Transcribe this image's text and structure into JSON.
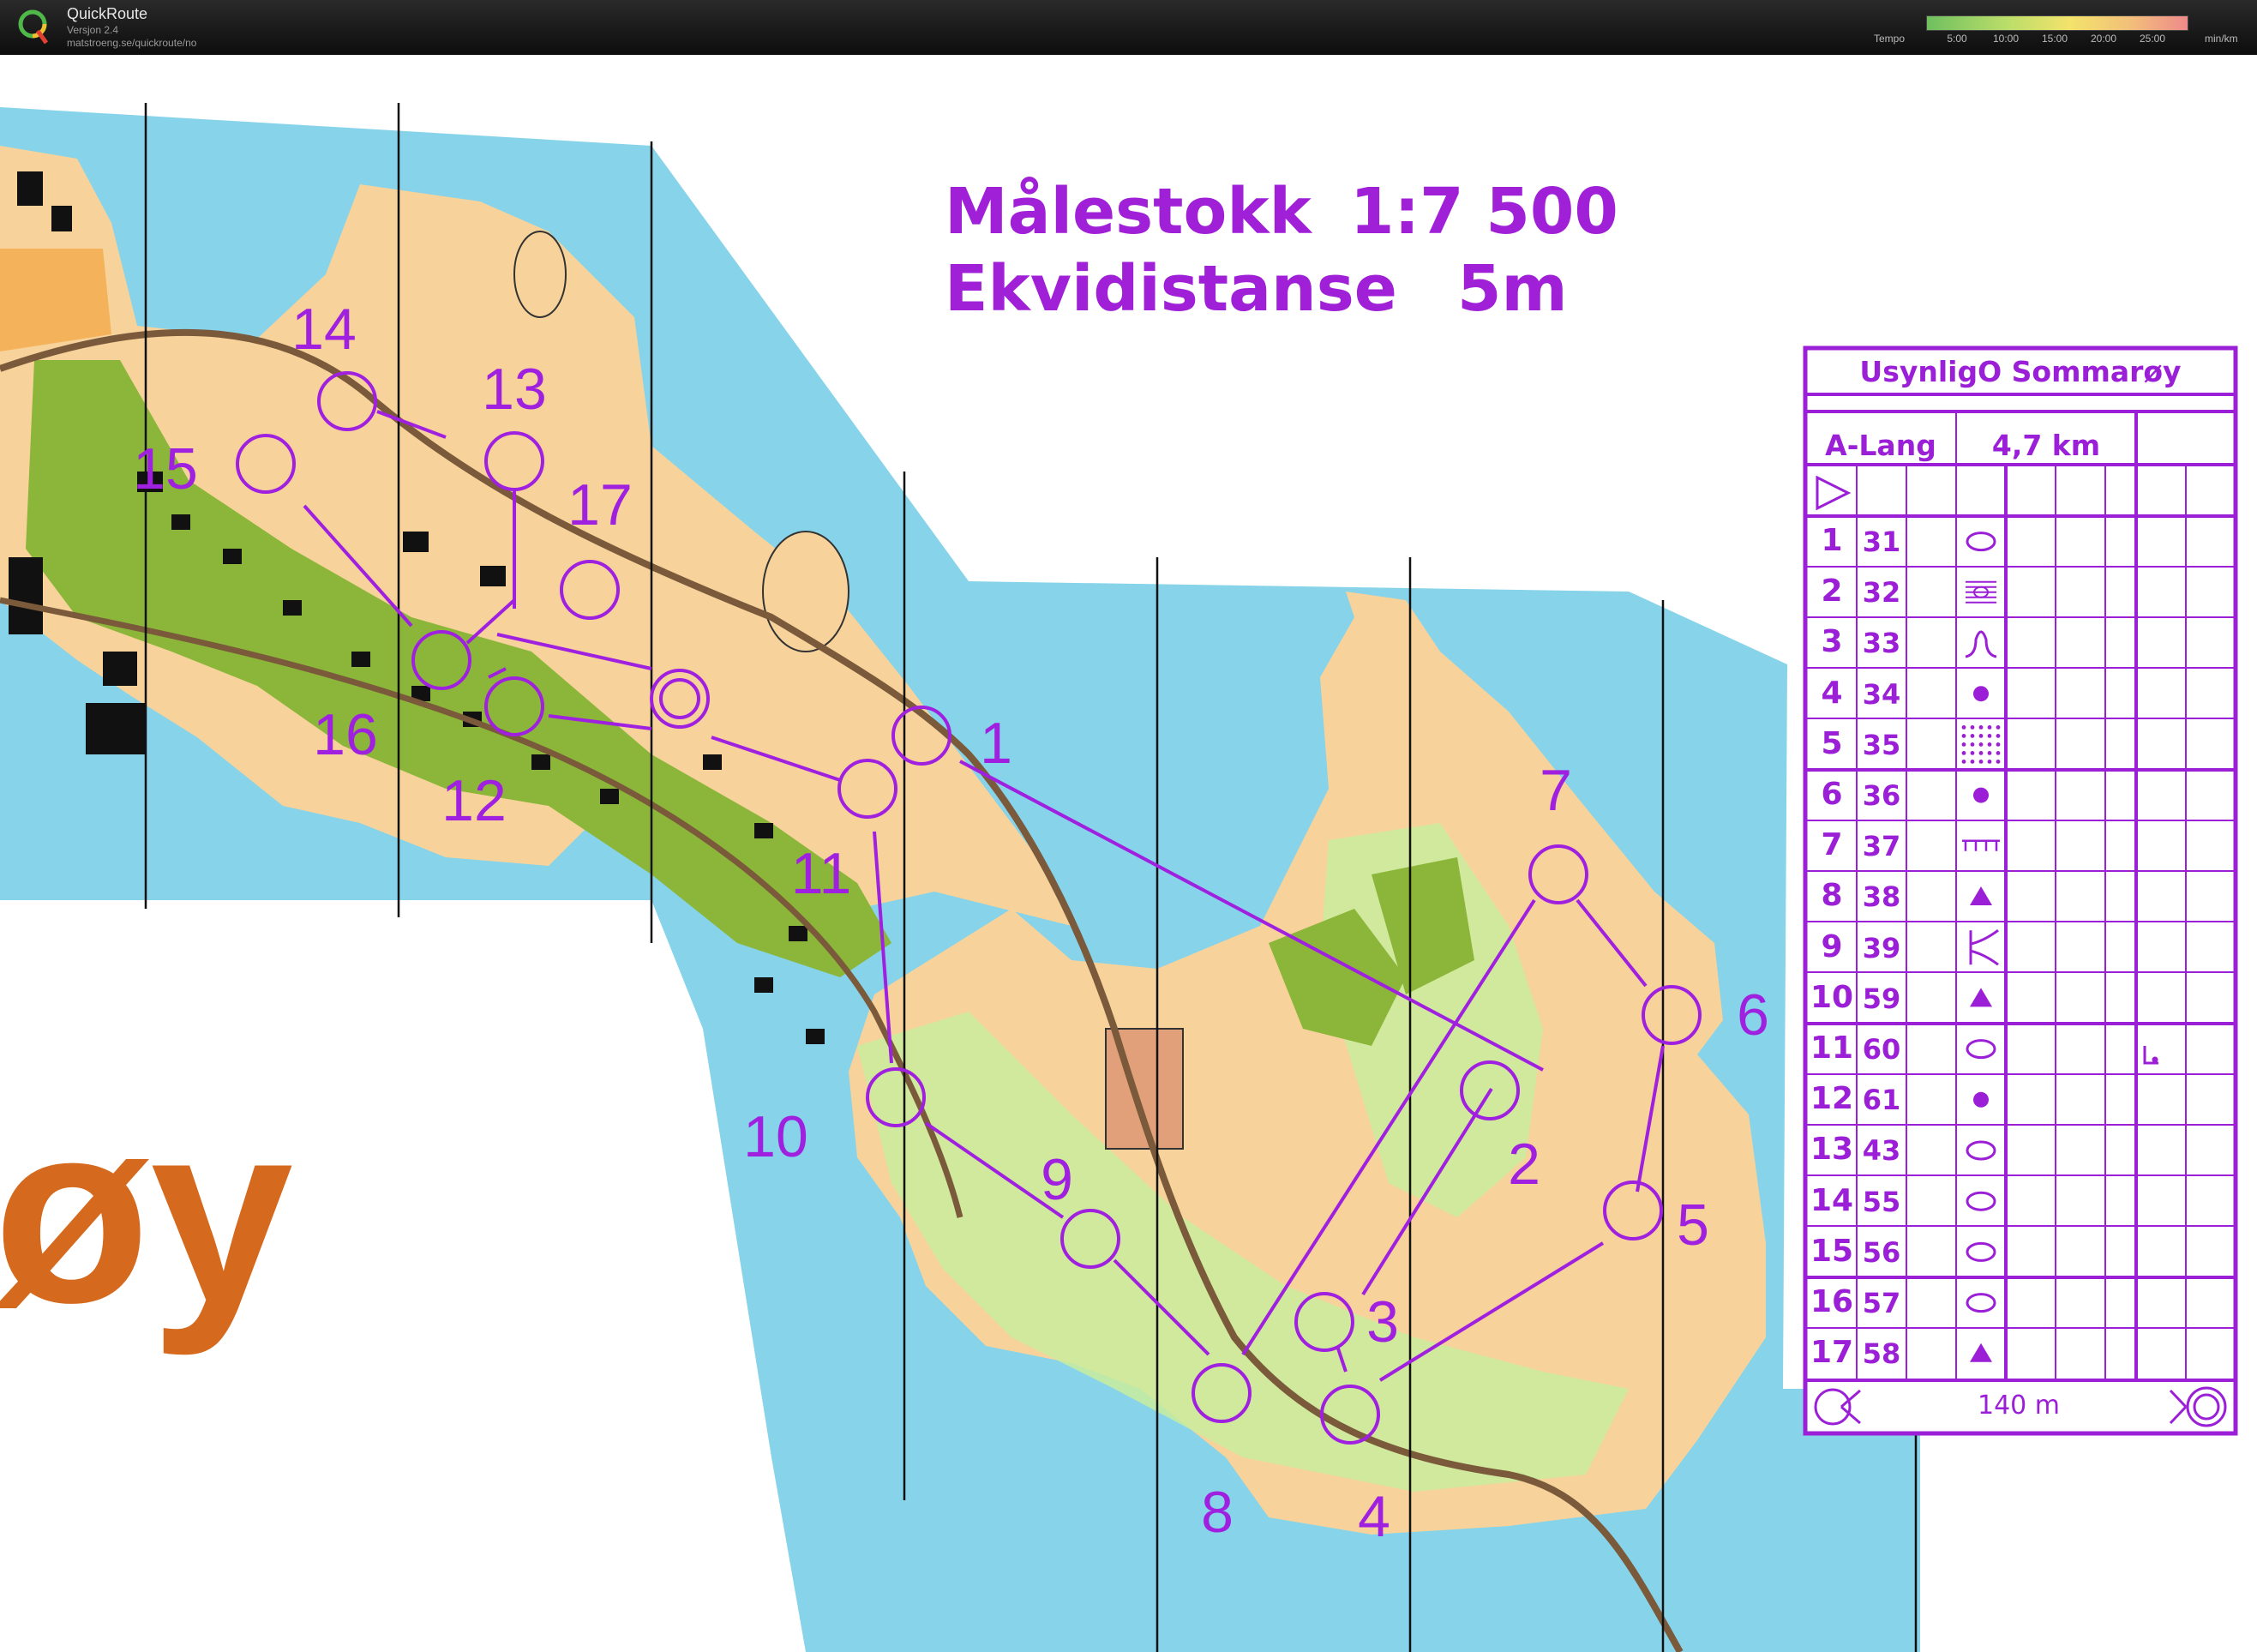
{
  "app": {
    "title": "QuickRoute",
    "version": "Versjon 2.4",
    "url": "matstroeng.se/quickroute/no"
  },
  "tempo_scale": {
    "label": "Tempo",
    "ticks": [
      "5:00",
      "10:00",
      "15:00",
      "20:00",
      "25:00"
    ],
    "unit": "min/km",
    "colors": [
      "#7ec86b",
      "#c7e36a",
      "#f4e36b",
      "#f2c37e",
      "#ef8e8e"
    ]
  },
  "map": {
    "scale_label": "Målestokk",
    "scale_value": "1:7 500",
    "contour_label": "Ekvidistanse",
    "contour_value": "5m",
    "place_text": "øy",
    "colors": {
      "water": "#86d3ea",
      "open_land": "#f7d39b",
      "forest_green": "#7aae2e",
      "light_green": "#c9ec9e",
      "course_purple": "#a020e0",
      "building": "#111111",
      "place_text": "#d56a1e"
    }
  },
  "control_description": {
    "event": "UsynligO Sommarøy",
    "class": "A-Lang",
    "length": "4,7 km",
    "finish_distance": "140 m",
    "controls": [
      {
        "n": "1",
        "code": "31",
        "symbol": "ellipse"
      },
      {
        "n": "2",
        "code": "32",
        "symbol": "lines"
      },
      {
        "n": "3",
        "code": "33",
        "symbol": "hill"
      },
      {
        "n": "4",
        "code": "34",
        "symbol": "dot"
      },
      {
        "n": "5",
        "code": "35",
        "symbol": "dots"
      },
      {
        "n": "6",
        "code": "36",
        "symbol": "dot"
      },
      {
        "n": "7",
        "code": "37",
        "symbol": "fence"
      },
      {
        "n": "8",
        "code": "38",
        "symbol": "triangle"
      },
      {
        "n": "9",
        "code": "39",
        "symbol": "fork"
      },
      {
        "n": "10",
        "code": "59",
        "symbol": "triangle"
      },
      {
        "n": "11",
        "code": "60",
        "symbol": "ellipse"
      },
      {
        "n": "12",
        "code": "61",
        "symbol": "dot"
      },
      {
        "n": "13",
        "code": "43",
        "symbol": "ellipse"
      },
      {
        "n": "14",
        "code": "55",
        "symbol": "ellipse"
      },
      {
        "n": "15",
        "code": "56",
        "symbol": "ellipse"
      },
      {
        "n": "16",
        "code": "57",
        "symbol": "ellipse"
      },
      {
        "n": "17",
        "code": "58",
        "symbol": "triangle"
      }
    ]
  },
  "course_labels": [
    "1",
    "2",
    "3",
    "4",
    "5",
    "6",
    "7",
    "8",
    "9",
    "10",
    "11",
    "12",
    "13",
    "14",
    "15",
    "16",
    "17"
  ]
}
